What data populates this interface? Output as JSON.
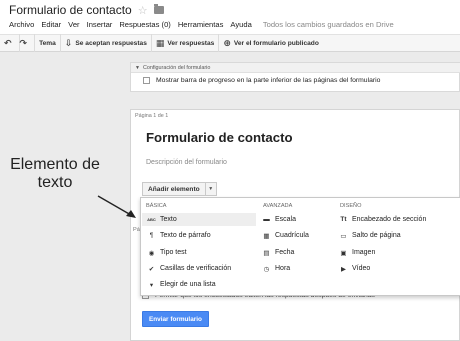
{
  "header": {
    "doc_title": "Formulario de contacto",
    "menu": [
      "Archivo",
      "Editar",
      "Ver",
      "Insertar",
      "Respuestas (0)",
      "Herramientas",
      "Ayuda"
    ],
    "save_status": "Todos los cambios guardados en Drive"
  },
  "toolbar": {
    "undo_icon": "undo-icon",
    "redo_icon": "redo-icon",
    "theme": "Tema",
    "accepting": "Se aceptan respuestas",
    "view_responses": "Ver respuestas",
    "view_published": "Ver el formulario publicado"
  },
  "settings": {
    "header": "Configuración del formulario",
    "progress_bar_option": "Mostrar barra de progreso en la parte inferior de las páginas del formulario"
  },
  "form": {
    "page_label": "Página 1 de 1",
    "title": "Formulario de contacto",
    "description_placeholder": "Descripción del formulario",
    "add_item": "Añadir elemento",
    "page_label_partial": "Pá",
    "bottom_option_partial": "Permitir que los encuestados editen las respuestas después de enviarlas",
    "submit": "Enviar formulario"
  },
  "dropdown": {
    "columns": [
      {
        "header": "BÁSICA",
        "items": [
          {
            "label": "Texto",
            "icon": "abc-icon",
            "glyph": "ABC",
            "selected": true
          },
          {
            "label": "Texto de párrafo",
            "icon": "pilcrow-icon",
            "glyph": "¶"
          },
          {
            "label": "Tipo test",
            "icon": "radio-icon",
            "glyph": "◉"
          },
          {
            "label": "Casillas de verificación",
            "icon": "checkmark-icon",
            "glyph": "✔"
          },
          {
            "label": "Elegir de una lista",
            "icon": "list-dropdown-icon",
            "glyph": "▾"
          }
        ]
      },
      {
        "header": "AVANZADA",
        "items": [
          {
            "label": "Escala",
            "icon": "scale-icon",
            "glyph": "▬"
          },
          {
            "label": "Cuadrícula",
            "icon": "grid-icon",
            "glyph": "▦"
          },
          {
            "label": "Fecha",
            "icon": "calendar-icon",
            "glyph": "▤"
          },
          {
            "label": "Hora",
            "icon": "clock-icon",
            "glyph": "◷"
          }
        ]
      },
      {
        "header": "DISEÑO",
        "items": [
          {
            "label": "Encabezado de sección",
            "icon": "section-header-icon",
            "glyph": "Tt"
          },
          {
            "label": "Salto de página",
            "icon": "page-break-icon",
            "glyph": "▭"
          },
          {
            "label": "Imagen",
            "icon": "image-icon",
            "glyph": "▣"
          },
          {
            "label": "Vídeo",
            "icon": "video-icon",
            "glyph": "▶"
          }
        ]
      }
    ]
  },
  "annotation": {
    "line1": "Elemento de",
    "line2": "texto"
  },
  "colors": {
    "accent_blue": "#4a8af4",
    "gray_background": "#ebebeb"
  }
}
